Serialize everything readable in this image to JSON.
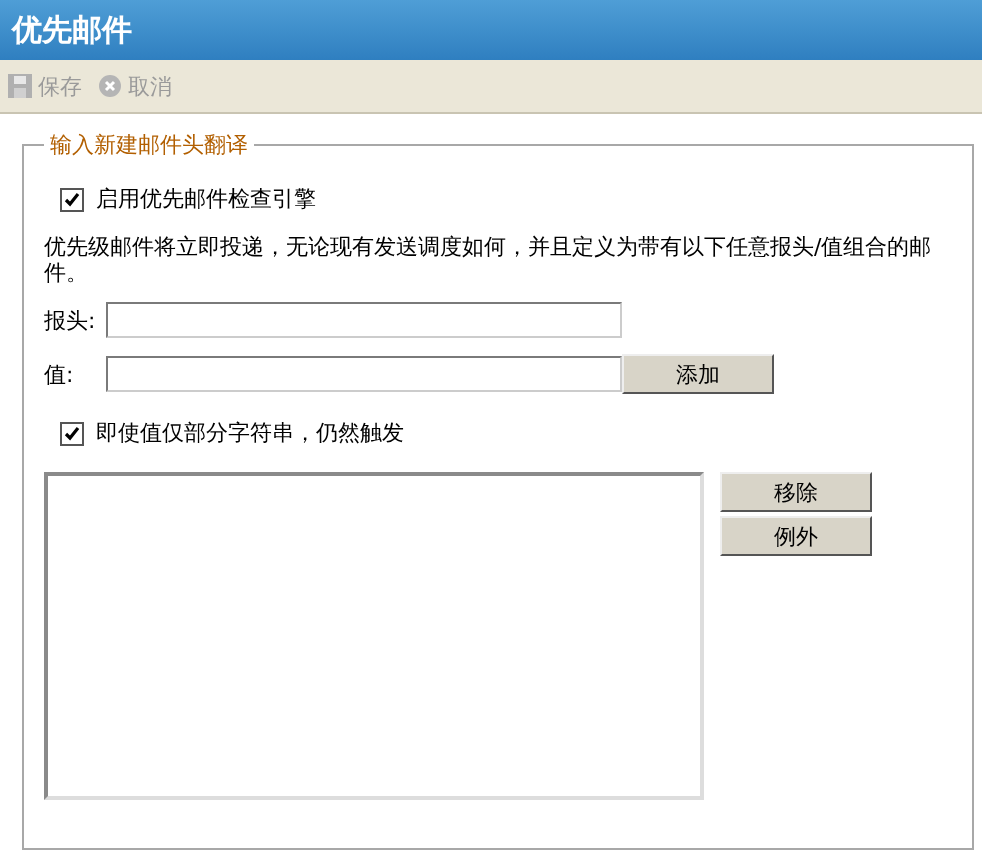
{
  "window": {
    "title": "优先邮件"
  },
  "toolbar": [
    {
      "label": "保存",
      "kind": "save",
      "disabled": true
    },
    {
      "label": "取消",
      "kind": "cancel",
      "disabled": true
    }
  ],
  "group": {
    "legend": "输入新建邮件头翻译",
    "enable": {
      "label": "启用优先邮件检查引擎",
      "checked": true
    },
    "description": "优先级邮件将立即投递，无论现有发送调度如何，并且定义为带有以下任意报头/值组合的邮件。",
    "header_field": {
      "label": "报头:"
    },
    "value_field": {
      "label": "值:"
    },
    "add_button": "添加",
    "partial": {
      "label": "即使值仅部分字符串，仍然触发",
      "checked": true
    },
    "list_buttons": [
      "移除",
      "例外"
    ]
  }
}
